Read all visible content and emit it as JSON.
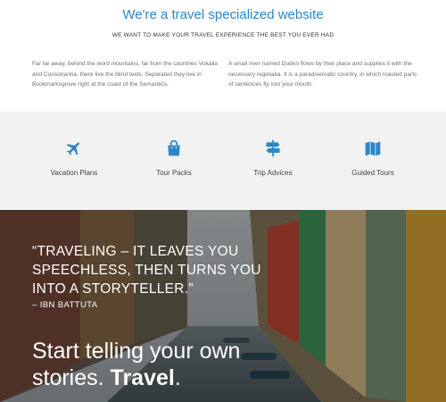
{
  "intro": {
    "title": "We're a travel specialized website",
    "subtitle": "WE WANT TO MAKE YOUR TRAVEL EXPERIENCE THE BEST YOU EVER HAD",
    "left_text": "Far far away, behind the word mountains, far from the countries Vokalia and Consonantia, there live the blind texts. Separated they live in Bookmarksgrove right at the coast of the Semantics.",
    "right_text": "A small river named Duden flows by their place and supplies it with the necessary regelialia. It is a paradisematic country, in which roasted parts of sentences fly into your mouth."
  },
  "features": [
    {
      "label": "Vacation Plans",
      "icon": "airplane-icon"
    },
    {
      "label": "Tour Packs",
      "icon": "shopping-bag-icon"
    },
    {
      "label": "Trip Advices",
      "icon": "signpost-icon"
    },
    {
      "label": "Guided Tours",
      "icon": "map-icon"
    }
  ],
  "accent_color": "#2a86c8",
  "hero": {
    "quote": "“TRAVELING – IT LEAVES YOU SPEECHLESS, THEN TURNS YOU INTO A STORYTELLER.”",
    "author": "– IBN BATTUTA",
    "cta_normal": "Start telling your own stories.",
    "cta_bold": "Travel",
    "cta_end": "."
  }
}
